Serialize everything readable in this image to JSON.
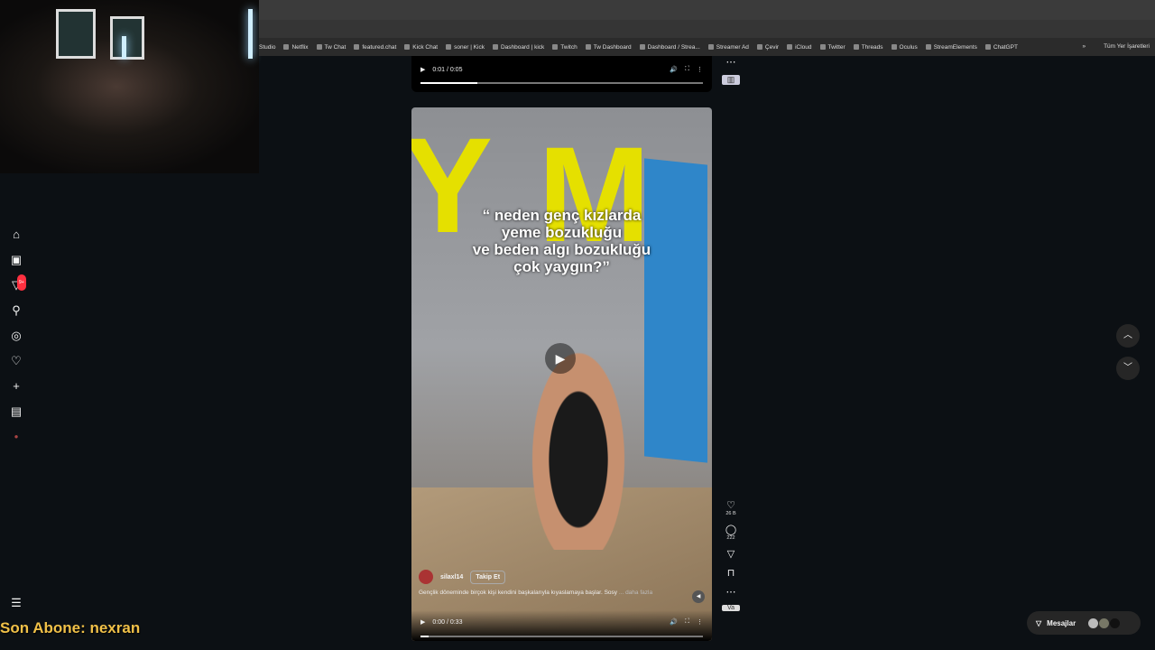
{
  "browser": {
    "bookmarks": [
      "Studio",
      "Netflix",
      "Tw Chat",
      "featured.chat",
      "Kick Chat",
      "soner | Kick",
      "Dashboard | kick",
      "Twitch",
      "Tw Dashboard",
      "Dashboard / Strea...",
      "Streamer Ad",
      "Çevir",
      "iCloud",
      "Twitter",
      "Threads",
      "Oculus",
      "StreamElements",
      "ChatGPT"
    ],
    "more": "»",
    "all_bookmarks": "Tüm Yer İşaretleri"
  },
  "sidebar": {
    "items": [
      "home-icon",
      "reels-icon",
      "messages-icon",
      "search-icon",
      "explore-icon",
      "notifications-icon",
      "create-icon",
      "dashboard-icon",
      "profile-icon"
    ],
    "messages_badge": "9+",
    "menu": "☰"
  },
  "top_video": {
    "time": "0:01 / 0:05",
    "progress": 0.2
  },
  "reel": {
    "caption": [
      "“ neden genç kızlarda",
      "yeme bozukluğu",
      "ve beden algı bozukluğu",
      "çok yaygın?”"
    ],
    "username": "silaxl14",
    "follow": "Takip Et",
    "description": "Gençlik döneminde birçok kişi kendini başkalarıyla kıyaslamaya başlar. Sosy",
    "more": "... daha fazla",
    "time": "0:00 / 0:33",
    "progress": 0.03,
    "likes": "26 B",
    "comments": "222"
  },
  "messages": {
    "label": "Mesajlar"
  },
  "overlay": {
    "subscriber": "Son Abone: nexran"
  }
}
